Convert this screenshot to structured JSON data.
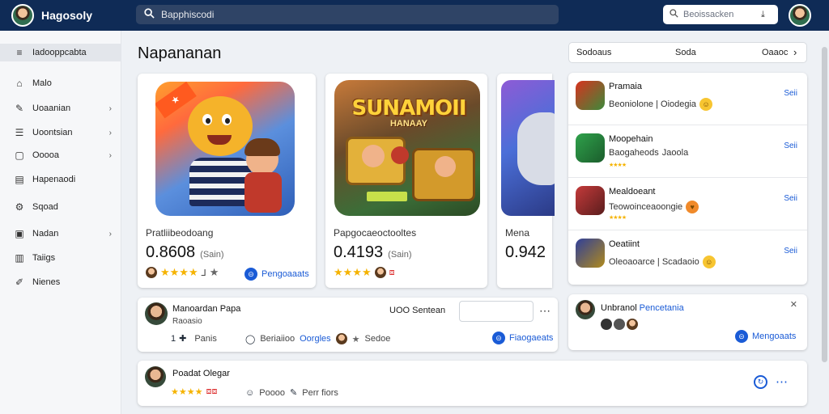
{
  "app": {
    "name": "Hagosoly"
  },
  "search": {
    "placeholder": "Bapphiscodi"
  },
  "search2": {
    "placeholder": "Beoissacken"
  },
  "sidebar": {
    "items": [
      {
        "label": "Iadooppcabta",
        "icon": "menu-icon",
        "active": true,
        "chevron": false
      },
      {
        "label": "Malo",
        "icon": "home-icon",
        "chevron": false
      },
      {
        "label": "Uoaanian",
        "icon": "pen-icon",
        "chevron": true
      },
      {
        "label": "Uoontsian",
        "icon": "list-icon",
        "chevron": true
      },
      {
        "label": "Ooooa",
        "icon": "box-icon",
        "chevron": true
      },
      {
        "label": "Hapenaodi",
        "icon": "doc-icon",
        "chevron": false
      },
      {
        "label": "Sqoad",
        "icon": "gear-icon",
        "chevron": false
      },
      {
        "label": "Nadan",
        "icon": "image-icon",
        "chevron": true
      },
      {
        "label": "Taiigs",
        "icon": "chart-icon",
        "chevron": false
      },
      {
        "label": "Nienes",
        "icon": "edit-icon",
        "chevron": false
      }
    ]
  },
  "main": {
    "title": "Napananan"
  },
  "cards": [
    {
      "label": "Pratliibeodoang",
      "value": "0.8608",
      "unit": "(Sain)",
      "link": "Pengoaaats"
    },
    {
      "label": "Papgocaeoctooltes",
      "value": "0.4193",
      "unit": "(Sain)",
      "art_title": "SUNAMOII",
      "art_subtitle": "HANAAY"
    },
    {
      "label": "Mena",
      "value": "0.942"
    }
  ],
  "sortbar": {
    "left": "Sodoaus",
    "middle": "Soda",
    "right": "Oaaoc"
  },
  "list": [
    {
      "title": "Pramaia",
      "sub": "Beoniolone | Oiodegia",
      "action": "Seii",
      "colors": [
        "#d8321f",
        "#3c8a3a"
      ]
    },
    {
      "title": "Moopehain",
      "sub": "Baogaheods",
      "sub2": "Jaoola",
      "action": "Seii",
      "colors": [
        "#2fa14b",
        "#1b5d2c"
      ]
    },
    {
      "title": "Mealdoeant",
      "sub": "Teowoinceaoongie",
      "action": "Seii",
      "colors": [
        "#c43a3a",
        "#5a1d1d"
      ]
    },
    {
      "title": "Oeatiint",
      "sub": "Oleoaoarce | Scadaoio",
      "action": "Seii",
      "colors": [
        "#2f3f9a",
        "#b08a1c"
      ]
    }
  ],
  "post1": {
    "name": "Manoardan Papa",
    "sub": "Raoasio",
    "count": "1",
    "btn": "Panis",
    "meta1": "Beriaiioo",
    "meta2": "Oorgles",
    "meta3": "Sedoe",
    "field_label": "UOO Sentean",
    "link": "Fiaogaeats"
  },
  "post2": {
    "name": "Unbranol",
    "name2": "Pencetania",
    "link": "Mengoaats"
  },
  "post3": {
    "name": "Poadat Olegar",
    "meta1": "Poooo",
    "meta2": "Perr fiors"
  }
}
